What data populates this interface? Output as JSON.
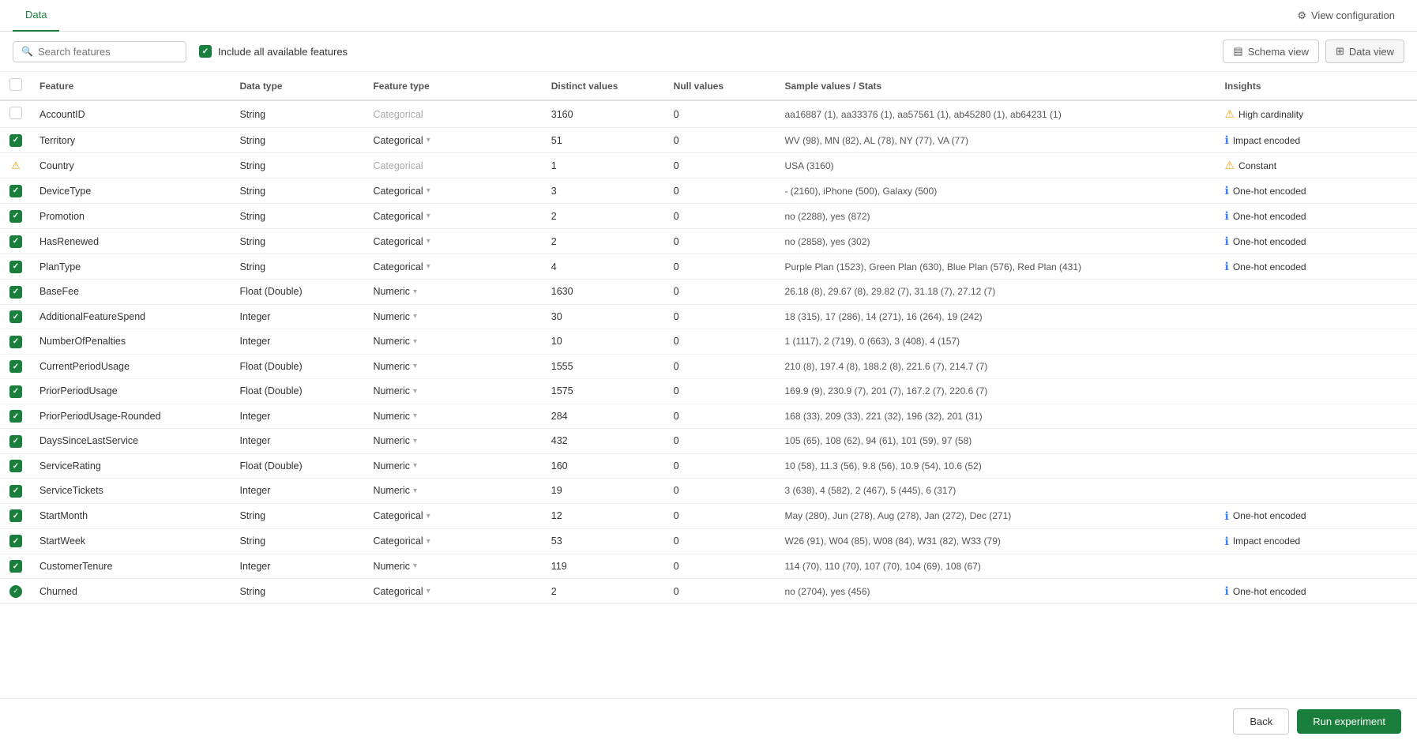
{
  "nav": {
    "tabs": [
      {
        "label": "Data",
        "active": true
      },
      {
        "label": "View configuration",
        "icon": "config-icon"
      }
    ],
    "view_config_label": "View configuration"
  },
  "toolbar": {
    "search_placeholder": "Search features",
    "include_all_label": "Include all available features",
    "schema_view_label": "Schema view",
    "data_view_label": "Data view"
  },
  "table": {
    "columns": [
      "",
      "Feature",
      "Data type",
      "Feature type",
      "Distinct values",
      "Null values",
      "Sample values / Stats",
      "Insights"
    ],
    "rows": [
      {
        "checked": "unchecked",
        "feature": "AccountID",
        "datatype": "String",
        "featuretype": "Categorical",
        "featuretype_gray": true,
        "distinct": "3160",
        "null": "0",
        "sample": "aa16887 (1), aa33376 (1), aa57561 (1), ab45280 (1), ab64231 (1)",
        "insight": "High cardinality",
        "insight_type": "warn"
      },
      {
        "checked": "checked",
        "feature": "Territory",
        "datatype": "String",
        "featuretype": "Categorical",
        "featuretype_gray": false,
        "distinct": "51",
        "null": "0",
        "sample": "WV (98), MN (82), AL (78), NY (77), VA (77)",
        "insight": "Impact encoded",
        "insight_type": "info"
      },
      {
        "checked": "warn",
        "feature": "Country",
        "datatype": "String",
        "featuretype": "Categorical",
        "featuretype_gray": true,
        "distinct": "1",
        "null": "0",
        "sample": "USA (3160)",
        "insight": "Constant",
        "insight_type": "warn",
        "row_icon": "warn"
      },
      {
        "checked": "checked",
        "feature": "DeviceType",
        "datatype": "String",
        "featuretype": "Categorical",
        "featuretype_gray": false,
        "distinct": "3",
        "null": "0",
        "sample": "- (2160), iPhone (500), Galaxy (500)",
        "insight": "One-hot encoded",
        "insight_type": "info"
      },
      {
        "checked": "checked",
        "feature": "Promotion",
        "datatype": "String",
        "featuretype": "Categorical",
        "featuretype_gray": false,
        "distinct": "2",
        "null": "0",
        "sample": "no (2288), yes (872)",
        "insight": "One-hot encoded",
        "insight_type": "info"
      },
      {
        "checked": "checked",
        "feature": "HasRenewed",
        "datatype": "String",
        "featuretype": "Categorical",
        "featuretype_gray": false,
        "distinct": "2",
        "null": "0",
        "sample": "no (2858), yes (302)",
        "insight": "One-hot encoded",
        "insight_type": "info"
      },
      {
        "checked": "checked",
        "feature": "PlanType",
        "datatype": "String",
        "featuretype": "Categorical",
        "featuretype_gray": false,
        "distinct": "4",
        "null": "0",
        "sample": "Purple Plan (1523), Green Plan (630), Blue Plan (576), Red Plan (431)",
        "insight": "One-hot encoded",
        "insight_type": "info"
      },
      {
        "checked": "checked",
        "feature": "BaseFee",
        "datatype": "Float (Double)",
        "featuretype": "Numeric",
        "featuretype_gray": false,
        "distinct": "1630",
        "null": "0",
        "sample": "26.18 (8), 29.67 (8), 29.82 (7), 31.18 (7), 27.12 (7)",
        "insight": "",
        "insight_type": ""
      },
      {
        "checked": "checked",
        "feature": "AdditionalFeatureSpend",
        "datatype": "Integer",
        "featuretype": "Numeric",
        "featuretype_gray": false,
        "distinct": "30",
        "null": "0",
        "sample": "18 (315), 17 (286), 14 (271), 16 (264), 19 (242)",
        "insight": "",
        "insight_type": ""
      },
      {
        "checked": "checked",
        "feature": "NumberOfPenalties",
        "datatype": "Integer",
        "featuretype": "Numeric",
        "featuretype_gray": false,
        "distinct": "10",
        "null": "0",
        "sample": "1 (1117), 2 (719), 0 (663), 3 (408), 4 (157)",
        "insight": "",
        "insight_type": ""
      },
      {
        "checked": "checked",
        "feature": "CurrentPeriodUsage",
        "datatype": "Float (Double)",
        "featuretype": "Numeric",
        "featuretype_gray": false,
        "distinct": "1555",
        "null": "0",
        "sample": "210 (8), 197.4 (8), 188.2 (8), 221.6 (7), 214.7 (7)",
        "insight": "",
        "insight_type": ""
      },
      {
        "checked": "checked",
        "feature": "PriorPeriodUsage",
        "datatype": "Float (Double)",
        "featuretype": "Numeric",
        "featuretype_gray": false,
        "distinct": "1575",
        "null": "0",
        "sample": "169.9 (9), 230.9 (7), 201 (7), 167.2 (7), 220.6 (7)",
        "insight": "",
        "insight_type": ""
      },
      {
        "checked": "checked",
        "feature": "PriorPeriodUsage-Rounded",
        "datatype": "Integer",
        "featuretype": "Numeric",
        "featuretype_gray": false,
        "distinct": "284",
        "null": "0",
        "sample": "168 (33), 209 (33), 221 (32), 196 (32), 201 (31)",
        "insight": "",
        "insight_type": ""
      },
      {
        "checked": "checked",
        "feature": "DaysSinceLastService",
        "datatype": "Integer",
        "featuretype": "Numeric",
        "featuretype_gray": false,
        "distinct": "432",
        "null": "0",
        "sample": "105 (65), 108 (62), 94 (61), 101 (59), 97 (58)",
        "insight": "",
        "insight_type": ""
      },
      {
        "checked": "checked",
        "feature": "ServiceRating",
        "datatype": "Float (Double)",
        "featuretype": "Numeric",
        "featuretype_gray": false,
        "distinct": "160",
        "null": "0",
        "sample": "10 (58), 11.3 (56), 9.8 (56), 10.9 (54), 10.6 (52)",
        "insight": "",
        "insight_type": ""
      },
      {
        "checked": "checked",
        "feature": "ServiceTickets",
        "datatype": "Integer",
        "featuretype": "Numeric",
        "featuretype_gray": false,
        "distinct": "19",
        "null": "0",
        "sample": "3 (638), 4 (582), 2 (467), 5 (445), 6 (317)",
        "insight": "",
        "insight_type": ""
      },
      {
        "checked": "checked",
        "feature": "StartMonth",
        "datatype": "String",
        "featuretype": "Categorical",
        "featuretype_gray": false,
        "distinct": "12",
        "null": "0",
        "sample": "May (280), Jun (278), Aug (278), Jan (272), Dec (271)",
        "insight": "One-hot encoded",
        "insight_type": "info"
      },
      {
        "checked": "checked",
        "feature": "StartWeek",
        "datatype": "String",
        "featuretype": "Categorical",
        "featuretype_gray": false,
        "distinct": "53",
        "null": "0",
        "sample": "W26 (91), W04 (85), W08 (84), W31 (82), W33 (79)",
        "insight": "Impact encoded",
        "insight_type": "info"
      },
      {
        "checked": "checked",
        "feature": "CustomerTenure",
        "datatype": "Integer",
        "featuretype": "Numeric",
        "featuretype_gray": false,
        "distinct": "119",
        "null": "0",
        "sample": "114 (70), 110 (70), 107 (70), 104 (69), 108 (67)",
        "insight": "",
        "insight_type": ""
      },
      {
        "checked": "target",
        "feature": "Churned",
        "datatype": "String",
        "featuretype": "Categorical",
        "featuretype_gray": false,
        "distinct": "2",
        "null": "0",
        "sample": "no (2704), yes (456)",
        "insight": "One-hot encoded",
        "insight_type": "info"
      }
    ]
  },
  "bottom": {
    "back_label": "Back",
    "run_label": "Run experiment"
  }
}
